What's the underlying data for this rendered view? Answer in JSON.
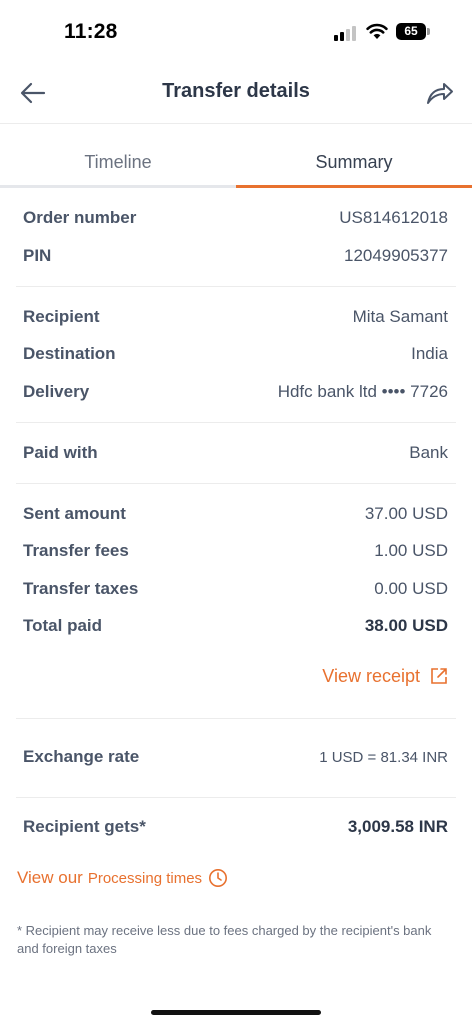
{
  "status_bar": {
    "time": "11:28",
    "battery": "65"
  },
  "nav": {
    "title": "Transfer details"
  },
  "tabs": [
    {
      "label": "Timeline"
    },
    {
      "label": "Summary"
    }
  ],
  "order": {
    "order_number_label": "Order number",
    "order_number": "US814612018",
    "pin_label": "PIN",
    "pin": "12049905377"
  },
  "recipient": {
    "recipient_label": "Recipient",
    "recipient": "Mita Samant",
    "destination_label": "Destination",
    "destination": "India",
    "delivery_label": "Delivery",
    "delivery": "Hdfc bank ltd •••• 7726"
  },
  "payment": {
    "paid_with_label": "Paid with",
    "paid_with": "Bank"
  },
  "amounts": {
    "sent_label": "Sent amount",
    "sent": "37.00 USD",
    "fees_label": "Transfer fees",
    "fees": "1.00 USD",
    "taxes_label": "Transfer taxes",
    "taxes": "0.00 USD",
    "total_label": "Total paid",
    "total": "38.00 USD"
  },
  "receipt": {
    "label": "View receipt"
  },
  "exchange": {
    "label": "Exchange rate",
    "value": "1 USD = 81.34 INR"
  },
  "recipient_gets": {
    "label": "Recipient gets*",
    "value": "3,009.58 INR"
  },
  "processing": {
    "prefix": "View our",
    "link": "Processing times"
  },
  "footnote": "* Recipient may receive less due to fees charged by the recipient's bank and foreign taxes",
  "colors": {
    "accent": "#e8712f",
    "text": "#4a5568",
    "divider": "#ececec"
  }
}
